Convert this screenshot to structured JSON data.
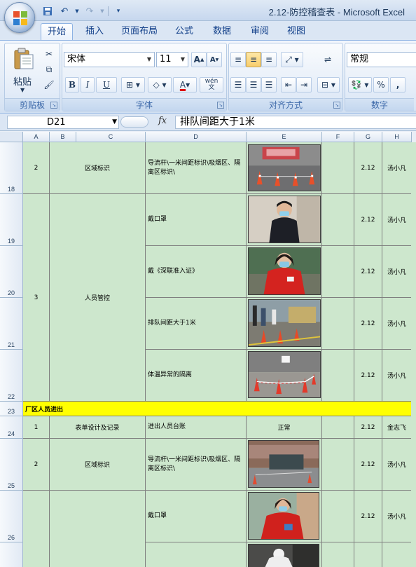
{
  "window": {
    "title": "2.12-防控稽查表 - Microsoft Excel"
  },
  "ribbon": {
    "tabs": [
      "开始",
      "插入",
      "页面布局",
      "公式",
      "数据",
      "审阅",
      "视图"
    ],
    "active_tab": "开始",
    "clipboard": {
      "paste_label": "粘贴",
      "group_label": "剪贴板"
    },
    "font": {
      "name": "宋体",
      "size": "11",
      "bold": "B",
      "italic": "I",
      "underline": "U",
      "wen": "wén\n文",
      "group_label": "字体"
    },
    "alignment": {
      "group_label": "对齐方式"
    },
    "number": {
      "format": "常规",
      "percent": "%",
      "comma": ",",
      "group_label": "数字"
    }
  },
  "formula_bar": {
    "name_box": "D21",
    "fx": "fx",
    "content": "排队间距大于1米"
  },
  "sheet": {
    "columns": [
      "A",
      "B",
      "C",
      "D",
      "E",
      "F",
      "G",
      "H"
    ],
    "row_numbers": [
      "18",
      "19",
      "20",
      "21",
      "22",
      "23",
      "24",
      "25",
      "26"
    ],
    "rows": [
      {
        "no": "2",
        "item": "区域标识",
        "detail": "导流杆\\一米间距标识\\吸烟区、隔离区标识\\",
        "photo": "barrier-area",
        "date": "2.12",
        "person": "汤小凡"
      },
      {
        "no": "",
        "item": "",
        "detail": "戴口罩",
        "photo": "guard-mask",
        "date": "2.12",
        "person": "汤小凡"
      },
      {
        "no": "",
        "item": "",
        "detail": "戴《深联准入证》",
        "photo": "red-coat-worker",
        "date": "2.12",
        "person": "汤小凡"
      },
      {
        "no": "3",
        "item": "人员管控",
        "detail": "排队间距大于1米",
        "photo": "queue-cones",
        "date": "2.12",
        "person": "汤小凡"
      },
      {
        "no": "",
        "item": "",
        "detail": "体温异常的隔离",
        "photo": "isolation-cones",
        "date": "2.12",
        "person": "汤小凡"
      }
    ],
    "section_header": "厂区人员进出",
    "row24": {
      "no": "1",
      "item": "表单设计及记录",
      "detail": "进出人员台账",
      "status": "正常",
      "date": "2.12",
      "person": "金志飞"
    },
    "row25": {
      "no": "2",
      "item": "区域标识",
      "detail": "导流杆\\一米间距标识\\吸烟区、隔离区标识\\",
      "date": "2.12",
      "person": "汤小凡"
    },
    "row26": {
      "detail": "戴口罩",
      "date": "2.12",
      "person": "汤小凡"
    }
  },
  "colors": {
    "cell_fill": "#cde7cd",
    "section_fill": "#ffff00",
    "ribbon_text": "#15428b"
  }
}
